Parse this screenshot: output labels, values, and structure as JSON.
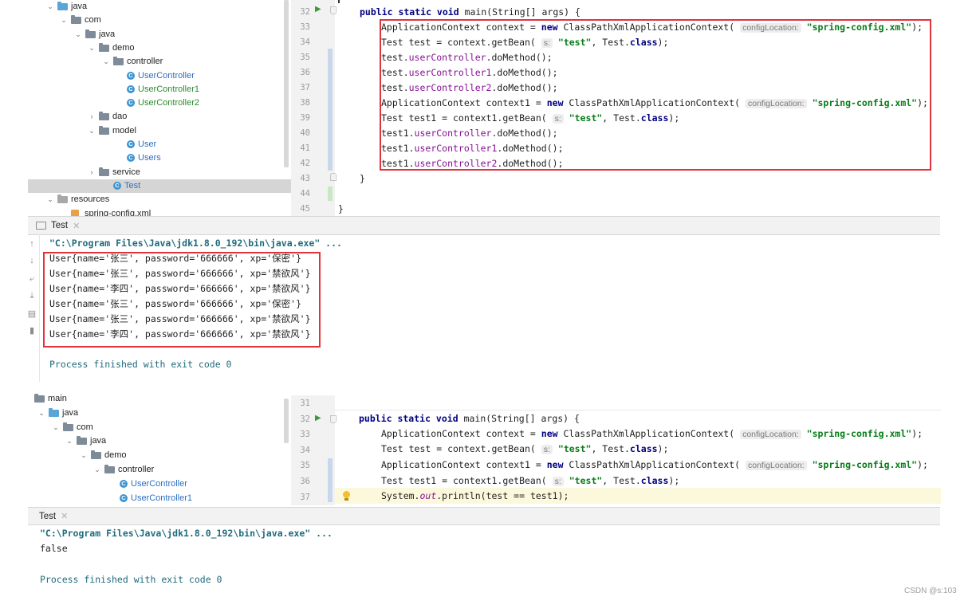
{
  "top": {
    "tree": [
      {
        "label": "java",
        "kind": "folder-blue",
        "arrow": "∨"
      },
      {
        "label": "com",
        "kind": "folder",
        "arrow": "∨"
      },
      {
        "label": "java",
        "kind": "folder",
        "arrow": "∨"
      },
      {
        "label": "demo",
        "kind": "folder",
        "arrow": "∨"
      },
      {
        "label": "controller",
        "kind": "folder",
        "arrow": "∨"
      },
      {
        "label": "UserController",
        "kind": "class-blue",
        "arrow": ""
      },
      {
        "label": "UserController1",
        "kind": "class-green",
        "arrow": ""
      },
      {
        "label": "UserController2",
        "kind": "class-green",
        "arrow": ""
      },
      {
        "label": "dao",
        "kind": "folder",
        "arrow": ">"
      },
      {
        "label": "model",
        "kind": "folder",
        "arrow": "∨"
      },
      {
        "label": "User",
        "kind": "class-blue",
        "arrow": ""
      },
      {
        "label": "Users",
        "kind": "class-blue",
        "arrow": ""
      },
      {
        "label": "service",
        "kind": "folder",
        "arrow": ">"
      },
      {
        "label": "Test",
        "kind": "class-blue",
        "arrow": "",
        "selected": true
      },
      {
        "label": "resources",
        "kind": "folder-res",
        "arrow": "∨"
      },
      {
        "label": "spring-config.xml",
        "kind": "xml",
        "arrow": ""
      }
    ],
    "line_numbers": [
      "32",
      "33",
      "34",
      "35",
      "36",
      "37",
      "38",
      "39",
      "40",
      "41",
      "42",
      "43",
      "44",
      "45"
    ],
    "code": {
      "main_sig_kw1": "public static void",
      "main_sig_rest": " main(String[] args) {",
      "l33_a": "ApplicationContext context = ",
      "l33_new": "new",
      "l33_b": " ClassPathXmlApplicationContext( ",
      "l33_hint": "configLocation:",
      "l33_str": "\"spring-config.xml\"",
      "l33_c": ");",
      "l34_a": "Test test = context.getBean( ",
      "l34_hint": "s:",
      "l34_str": "\"test\"",
      "l34_b": ", Test.",
      "l34_kw": "class",
      "l34_c": ");",
      "l35_a": "test.",
      "l35_f": "userController",
      "l35_b": ".doMethod();",
      "l36_a": "test.",
      "l36_f": "userController1",
      "l36_b": ".doMethod();",
      "l37_a": "test.",
      "l37_f": "userController2",
      "l37_b": ".doMethod();",
      "l38_a": "ApplicationContext context1 = ",
      "l38_new": "new",
      "l38_b": " ClassPathXmlApplicationContext( ",
      "l38_hint": "configLocation:",
      "l38_str": "\"spring-config.xml\"",
      "l38_c": ");",
      "l39_a": "Test test1 = context1.getBean( ",
      "l39_hint": "s:",
      "l39_str": "\"test\"",
      "l39_b": ", Test.",
      "l39_kw": "class",
      "l39_c": ");",
      "l40_a": "test1.",
      "l40_f": "userController",
      "l40_b": ".doMethod();",
      "l41_a": "test1.",
      "l41_f": "userController1",
      "l41_b": ".doMethod();",
      "l42_a": "test1.",
      "l42_f": "userController2",
      "l42_b": ".doMethod();",
      "close_inner": "}",
      "close_outer": "}"
    },
    "tab_label": "Test",
    "console": {
      "command": "\"C:\\Program Files\\Java\\jdk1.8.0_192\\bin\\java.exe\" ...",
      "lines": [
        "User{name='张三', password='666666', xp='保密'}",
        "User{name='张三', password='666666', xp='禁欲风'}",
        "User{name='李四', password='666666', xp='禁欲风'}",
        "User{name='张三', password='666666', xp='保密'}",
        "User{name='张三', password='666666', xp='禁欲风'}",
        "User{name='李四', password='666666', xp='禁欲风'}"
      ],
      "finished": "Process finished with exit code 0"
    }
  },
  "bottom": {
    "tree": [
      {
        "label": "main",
        "kind": "folder",
        "arrow": ""
      },
      {
        "label": "java",
        "kind": "folder-blue",
        "arrow": "∨"
      },
      {
        "label": "com",
        "kind": "folder",
        "arrow": "∨"
      },
      {
        "label": "java",
        "kind": "folder",
        "arrow": "∨"
      },
      {
        "label": "demo",
        "kind": "folder",
        "arrow": "∨"
      },
      {
        "label": "controller",
        "kind": "folder",
        "arrow": "∨"
      },
      {
        "label": "UserController",
        "kind": "class-blue",
        "arrow": ""
      },
      {
        "label": "UserController1",
        "kind": "class-blue",
        "arrow": ""
      }
    ],
    "line_numbers": [
      "31",
      "32",
      "33",
      "34",
      "35",
      "36",
      "37"
    ],
    "code": {
      "main_sig_kw1": "public static void",
      "main_sig_rest": " main(String[] args) {",
      "l33_a": "ApplicationContext context = ",
      "l33_new": "new",
      "l33_b": " ClassPathXmlApplicationContext( ",
      "l33_hint": "configLocation:",
      "l33_str": "\"spring-config.xml\"",
      "l33_c": ");",
      "l34_a": "Test test = context.getBean( ",
      "l34_hint": "s:",
      "l34_str": "\"test\"",
      "l34_b": ", Test.",
      "l34_kw": "class",
      "l34_c": ");",
      "l35_a": "ApplicationContext context1 = ",
      "l35_new": "new",
      "l35_b": " ClassPathXmlApplicationContext( ",
      "l35_hint": "configLocation:",
      "l35_str": "\"spring-config.xml\"",
      "l35_c": ");",
      "l36_a": "Test test1 = context1.getBean( ",
      "l36_hint": "s:",
      "l36_str": "\"test\"",
      "l36_b": ", Test.",
      "l36_kw": "class",
      "l36_c": ");",
      "l37_a": "System.",
      "l37_f": "out",
      "l37_b": ".println(test == test1);"
    },
    "tab_label": "Test",
    "console": {
      "command": "\"C:\\Program Files\\Java\\jdk1.8.0_192\\bin\\java.exe\" ...",
      "output": "false",
      "finished": "Process finished with exit code 0"
    }
  },
  "watermark": "CSDN @s:103",
  "colors": {
    "highlight_box": "#e0333c",
    "keyword": "#000080",
    "string": "#067d17",
    "field": "#871094",
    "console_cmd": "#1f6b7c"
  }
}
